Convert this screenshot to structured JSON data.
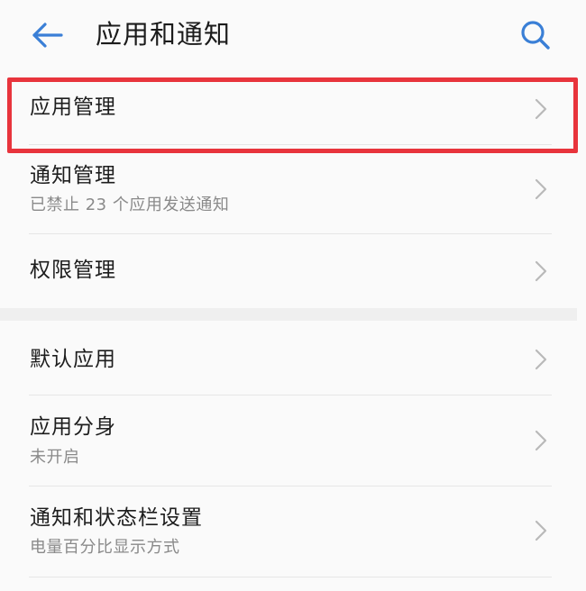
{
  "header": {
    "title": "应用和通知",
    "back_icon": "arrow-left-icon",
    "search_icon": "search-icon",
    "accent_color": "#3a7fd6"
  },
  "items": [
    {
      "title": "应用管理",
      "subtitle": ""
    },
    {
      "title": "通知管理",
      "subtitle": "已禁止 23 个应用发送通知"
    },
    {
      "title": "权限管理",
      "subtitle": ""
    },
    {
      "title": "默认应用",
      "subtitle": ""
    },
    {
      "title": "应用分身",
      "subtitle": "未开启"
    },
    {
      "title": "通知和状态栏设置",
      "subtitle": "电量百分比显示方式"
    }
  ],
  "highlight_color": "#e8343c"
}
